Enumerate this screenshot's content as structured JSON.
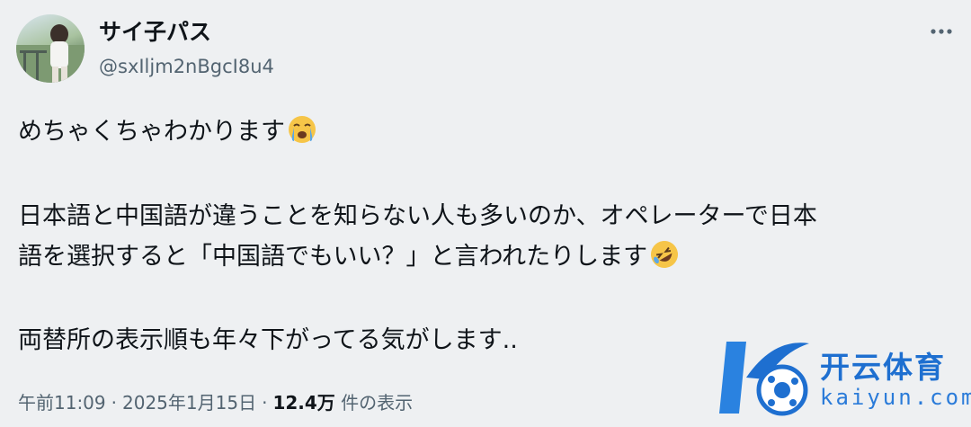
{
  "author": {
    "display_name": "サイ子パス",
    "handle": "@sxIljm2nBgcI8u4"
  },
  "post": {
    "line1": "めちゃくちゃわかります",
    "line2a": "日本語と中国語が違うことを知らない人も多いのか、オペレーターで日本",
    "line2b": "語を選択すると「中国語でもいい？」と言われたりします",
    "line3": "両替所の表示順も年々下がってる気がします.."
  },
  "meta": {
    "time": "午前11:09",
    "date": "2025年1月15日",
    "views_count": "12.4万",
    "views_label": "件の表示"
  },
  "watermark": {
    "brand_cn": "开云体育",
    "brand_en": "kaiyun.com"
  },
  "icons": {
    "more": "more-options-icon",
    "crying": "loudly-crying-face-emoji",
    "rolling": "rolling-on-floor-laughing-emoji"
  }
}
